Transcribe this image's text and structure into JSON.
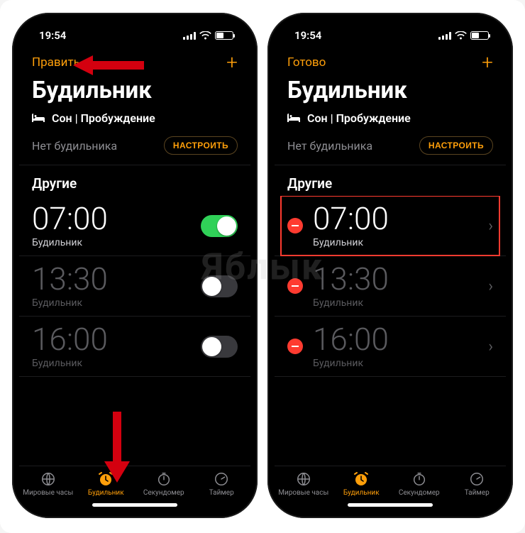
{
  "watermark": "Яблык",
  "status": {
    "time": "19:54"
  },
  "accent": "#ff9f0a",
  "left": {
    "nav_left": "Править",
    "add_symbol": "+",
    "title": "Будильник",
    "sleep_section": "Сон | Пробуждение",
    "no_alarm": "Нет будильника",
    "configure": "НАСТРОИТЬ",
    "other_section": "Другие",
    "alarms": [
      {
        "time": "07:00",
        "label": "Будильник",
        "on": true
      },
      {
        "time": "13:30",
        "label": "Будильник",
        "on": false
      },
      {
        "time": "16:00",
        "label": "Будильник",
        "on": false
      }
    ]
  },
  "right": {
    "nav_left": "Готово",
    "add_symbol": "+",
    "title": "Будильник",
    "sleep_section": "Сон | Пробуждение",
    "no_alarm": "Нет будильника",
    "configure": "НАСТРОИТЬ",
    "other_section": "Другие",
    "alarms": [
      {
        "time": "07:00",
        "label": "Будильник",
        "highlighted": true
      },
      {
        "time": "13:30",
        "label": "Будильник",
        "dim": true
      },
      {
        "time": "16:00",
        "label": "Будильник",
        "dim": true
      }
    ]
  },
  "tabs": {
    "world": "Мировые часы",
    "alarm": "Будильник",
    "stopwatch": "Секундомер",
    "timer": "Таймер"
  }
}
